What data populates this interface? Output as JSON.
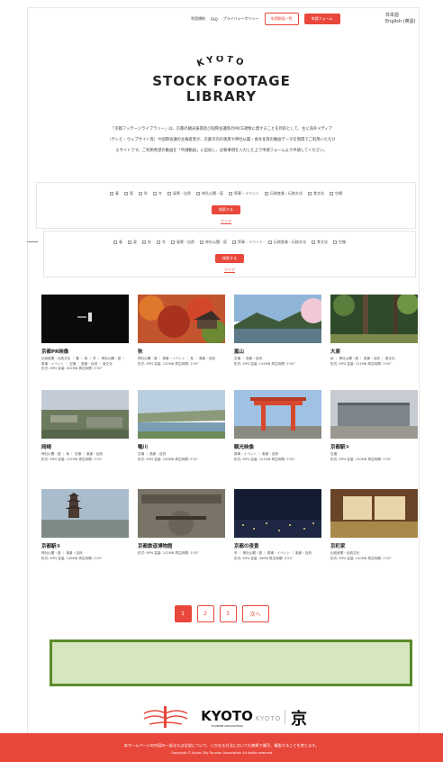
{
  "header": {
    "nav": [
      "利用規約",
      "FAQ",
      "プライバシーポリシー"
    ],
    "request_list_button": "申請動画一覧",
    "request_form_button": "申請フォーム",
    "lang_ja": "日本語",
    "lang_en": "English (英語)"
  },
  "logo": {
    "top": "KYOTO",
    "line1": "STOCK FOOTAGE",
    "line2": "LIBRARY"
  },
  "intro": {
    "line1": "「京都フッテージライブラリー」は、京都の観光振興及び国際会議等のMICE誘致に資することを目的として、主に海外メディア",
    "line2": "（テレビ・ウェブサイト等）や国際会議の主催者等が、京都市内の風景や神社仏閣・食文化等の動画データを無償でご利用いただけ",
    "line3": "るサイトです。ご利用希望の動画を「申請動画」に追加し、必要事項を入力した上で申請フォームより申請してください。"
  },
  "filter": {
    "options": [
      "春",
      "夏",
      "秋",
      "冬",
      "風景・自然",
      "神社仏閣・庭",
      "祭事・イベント",
      "伝統産業・伝統文化",
      "食文化",
      "空撮"
    ],
    "search_button": "検索する",
    "clear_link": "クリア"
  },
  "cards": [
    {
      "title": "京都PR映像",
      "tags": "伝統産業・伝統文化 ｜ 春 ｜ 秋 ｜ 冬 ｜ 神社仏閣・庭 ｜ 祭事・イベント ｜ 空撮 ｜ 風景・自然 ｜ 食文化",
      "meta": "形式: MP4 容量: 452MB 再生時間: 2'50\""
    },
    {
      "title": "秋",
      "tags": "神社仏閣・庭 ｜ 祭事・イベント ｜ 秋 ｜ 風景・自然",
      "meta": "形式: MP4 容量: 152MB 再生時間: 1'00\""
    },
    {
      "title": "嵐山",
      "tags": "空撮 ｜ 風景・自然",
      "meta": "形式: MP4 容量: 154MB 再生時間: 1'00\""
    },
    {
      "title": "大原",
      "tags": "秋 ｜ 神社仏閣・庭 ｜ 風景・自然 ｜ 食文化",
      "meta": "形式: MP4 容量: 151MB 再生時間: 1'00\""
    },
    {
      "title": "岡崎",
      "tags": "神社仏閣・庭 ｜ 秋 ｜ 空撮 ｜ 風景・自然",
      "meta": "形式: MP4 容量: 152MB 再生時間: 1'00\""
    },
    {
      "title": "鴨川",
      "tags": "空撮 ｜ 風景・自然",
      "meta": "形式: MP4 容量: 163MB 再生時間: 0'41\""
    },
    {
      "title": "観光映像",
      "tags": "祭事・イベント ｜ 風景・自然",
      "meta": "形式: MP4 容量: 101MB 再生時間: 1'00\""
    },
    {
      "title": "京都駅①",
      "tags": "空撮",
      "meta": "形式: MP4 容量: 150MB 再生時間: 1'00\""
    },
    {
      "title": "京都駅②",
      "tags": "神社仏閣・庭 ｜ 風景・自然",
      "meta": "形式: MP4 容量: 148MB 再生時間: 1'00\""
    },
    {
      "title": "京都鉄道博物館",
      "tags": "",
      "meta": "形式: MP4 容量: 152MB 再生時間: 1'00\""
    },
    {
      "title": "京都の夜景",
      "tags": "冬 ｜ 神社仏閣・庭 ｜ 祭事・イベント ｜ 風景・自然",
      "meta": "形式: MP4 容量: 58MB 再生時間: 0'23\""
    },
    {
      "title": "京町家",
      "tags": "伝統産業・伝統文化",
      "meta": "形式: MP4 容量: 150MB 再生時間: 1'00\""
    }
  ],
  "pager": {
    "pages": [
      "1",
      "2",
      "3"
    ],
    "next": "次へ"
  },
  "footer_logos": {
    "kyoto": "KYOTO",
    "kyoto_sub": "TOURISM ASSOCIATION",
    "kyoto_gray": "KYOTO",
    "kyo": "京"
  },
  "footer": {
    "note": "本ホームページの内容の一部または全部について、いかなる方法においても無断で複写、複製することを禁じます。",
    "copyright": "Copyright © Kyoto City Tourism Association All rights reserved"
  },
  "colors": {
    "accent": "#e8473b",
    "green_fill": "#d6e6bf",
    "green_border": "#5b8a2c"
  }
}
